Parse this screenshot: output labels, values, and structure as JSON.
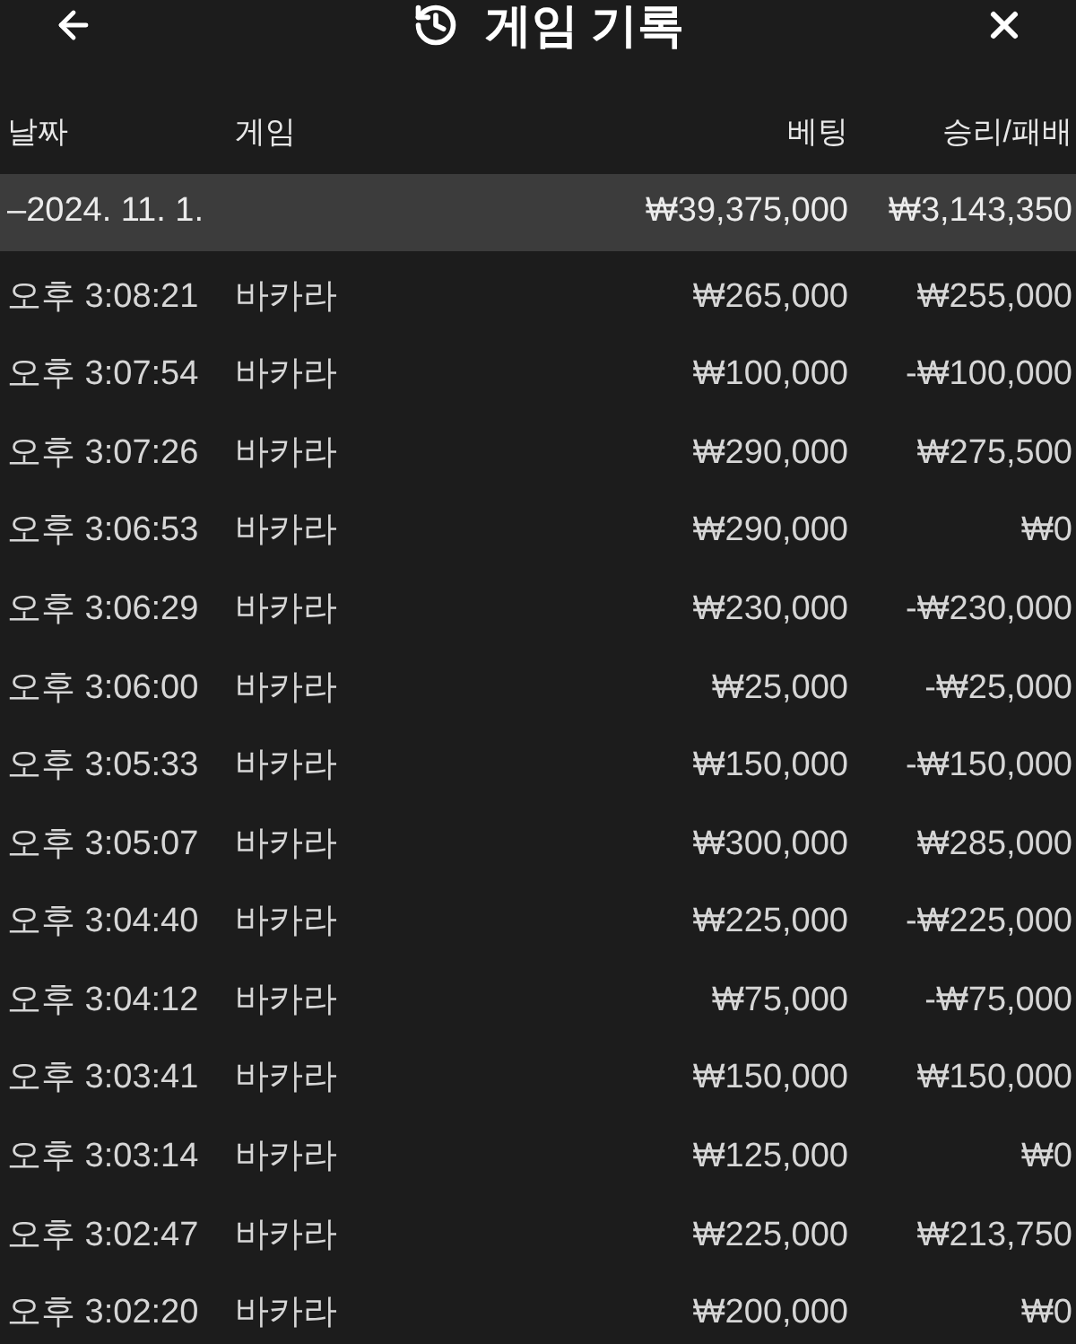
{
  "header": {
    "title": "게임 기록"
  },
  "table": {
    "columns": [
      "날짜",
      "게임",
      "베팅",
      "승리/패배"
    ],
    "groups": [
      {
        "date": "–2024. 11. 1.",
        "bet": "₩39,375,000",
        "result": "₩3,143,350",
        "rows": [
          {
            "time": "오후 3:08:21",
            "game": "바카라",
            "bet": "₩265,000",
            "result": "₩255,000"
          },
          {
            "time": "오후 3:07:54",
            "game": "바카라",
            "bet": "₩100,000",
            "result": "-₩100,000"
          },
          {
            "time": "오후 3:07:26",
            "game": "바카라",
            "bet": "₩290,000",
            "result": "₩275,500"
          },
          {
            "time": "오후 3:06:53",
            "game": "바카라",
            "bet": "₩290,000",
            "result": "₩0"
          },
          {
            "time": "오후 3:06:29",
            "game": "바카라",
            "bet": "₩230,000",
            "result": "-₩230,000"
          },
          {
            "time": "오후 3:06:00",
            "game": "바카라",
            "bet": "₩25,000",
            "result": "-₩25,000"
          },
          {
            "time": "오후 3:05:33",
            "game": "바카라",
            "bet": "₩150,000",
            "result": "-₩150,000"
          },
          {
            "time": "오후 3:05:07",
            "game": "바카라",
            "bet": "₩300,000",
            "result": "₩285,000"
          },
          {
            "time": "오후 3:04:40",
            "game": "바카라",
            "bet": "₩225,000",
            "result": "-₩225,000"
          },
          {
            "time": "오후 3:04:12",
            "game": "바카라",
            "bet": "₩75,000",
            "result": "-₩75,000"
          },
          {
            "time": "오후 3:03:41",
            "game": "바카라",
            "bet": "₩150,000",
            "result": "₩150,000"
          },
          {
            "time": "오후 3:03:14",
            "game": "바카라",
            "bet": "₩125,000",
            "result": "₩0"
          },
          {
            "time": "오후 3:02:47",
            "game": "바카라",
            "bet": "₩225,000",
            "result": "₩213,750"
          },
          {
            "time": "오후 3:02:20",
            "game": "바카라",
            "bet": "₩200,000",
            "result": "₩0"
          }
        ]
      }
    ]
  }
}
